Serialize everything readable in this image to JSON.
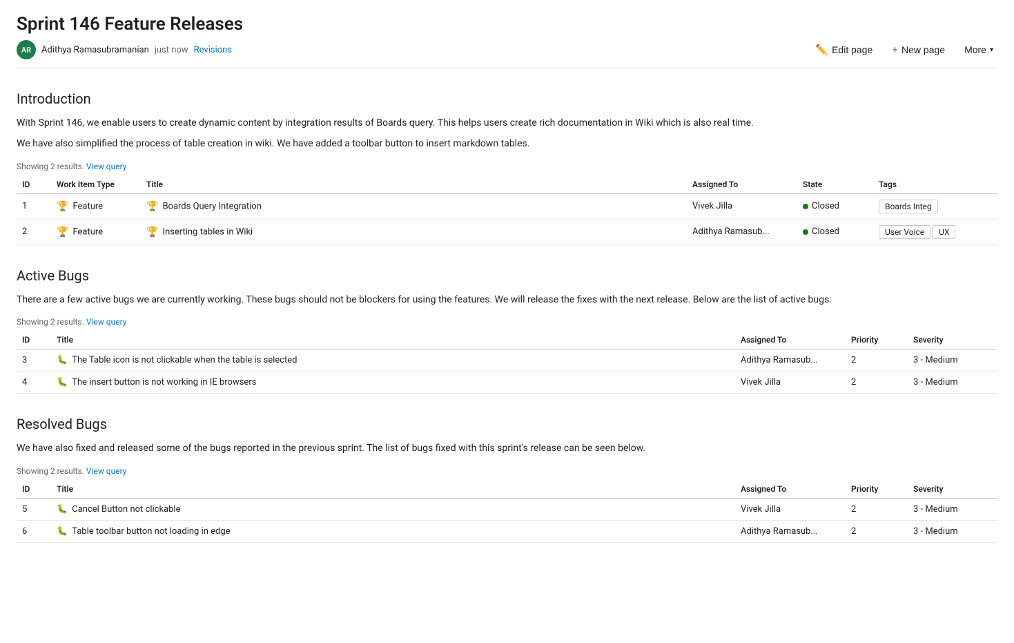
{
  "page": {
    "title": "Sprint 146 Feature Releases"
  },
  "meta": {
    "author_initials": "AR",
    "author_name": "Adithya Ramasubramanian",
    "time": "just now",
    "revisions_label": "Revisions"
  },
  "toolbar": {
    "edit_label": "Edit page",
    "new_page_label": "New page",
    "more_label": "More"
  },
  "sections": [
    {
      "id": "introduction",
      "heading": "Introduction",
      "paragraphs": [
        "With Sprint 146, we enable users to create dynamic content by integration results of Boards query. This helps users create rich documentation in Wiki which is also real time.",
        "We have also simplified the process of table creation in wiki. We have added a toolbar button to insert markdown tables."
      ],
      "showing": "Showing 2 results.",
      "view_query_label": "View query",
      "table_type": "features",
      "columns": [
        "ID",
        "Work Item Type",
        "Title",
        "Assigned To",
        "State",
        "Tags"
      ],
      "rows": [
        {
          "id": "1",
          "work_item_type": "Feature",
          "title": "Boards Query Integration",
          "assigned_to": "Vivek Jilla",
          "state": "Closed",
          "state_type": "closed",
          "tags": [
            "Boards Integ"
          ]
        },
        {
          "id": "2",
          "work_item_type": "Feature",
          "title": "Inserting tables in Wiki",
          "assigned_to": "Adithya Ramasub...",
          "state": "Closed",
          "state_type": "closed",
          "tags": [
            "User Voice",
            "UX"
          ]
        }
      ]
    },
    {
      "id": "active-bugs",
      "heading": "Active Bugs",
      "paragraphs": [
        "There are a few active bugs we are currently working. These bugs should not be blockers for using the features. We will release the fixes with the next release. Below are the list of active bugs:"
      ],
      "showing": "Showing 2 results.",
      "view_query_label": "View query",
      "table_type": "bugs",
      "columns": [
        "ID",
        "Title",
        "Assigned To",
        "Priority",
        "Severity"
      ],
      "rows": [
        {
          "id": "3",
          "title": "The Table icon is not clickable when the table is selected",
          "assigned_to": "Adithya Ramasub...",
          "priority": "2",
          "severity": "3 - Medium"
        },
        {
          "id": "4",
          "title": "The insert button is not working in IE browsers",
          "assigned_to": "Vivek Jilla",
          "priority": "2",
          "severity": "3 - Medium"
        }
      ]
    },
    {
      "id": "resolved-bugs",
      "heading": "Resolved Bugs",
      "paragraphs": [
        "We have also fixed and released some of the bugs reported in the previous sprint. The list of bugs fixed with this sprint's release can be seen below."
      ],
      "showing": "Showing 2 results.",
      "view_query_label": "View query",
      "table_type": "bugs",
      "columns": [
        "ID",
        "Title",
        "Assigned To",
        "Priority",
        "Severity"
      ],
      "rows": [
        {
          "id": "5",
          "title": "Cancel Button not clickable",
          "assigned_to": "Vivek Jilla",
          "priority": "2",
          "severity": "3 - Medium"
        },
        {
          "id": "6",
          "title": "Table toolbar button not loading in edge",
          "assigned_to": "Adithya Ramasub...",
          "priority": "2",
          "severity": "3 - Medium"
        }
      ]
    }
  ]
}
